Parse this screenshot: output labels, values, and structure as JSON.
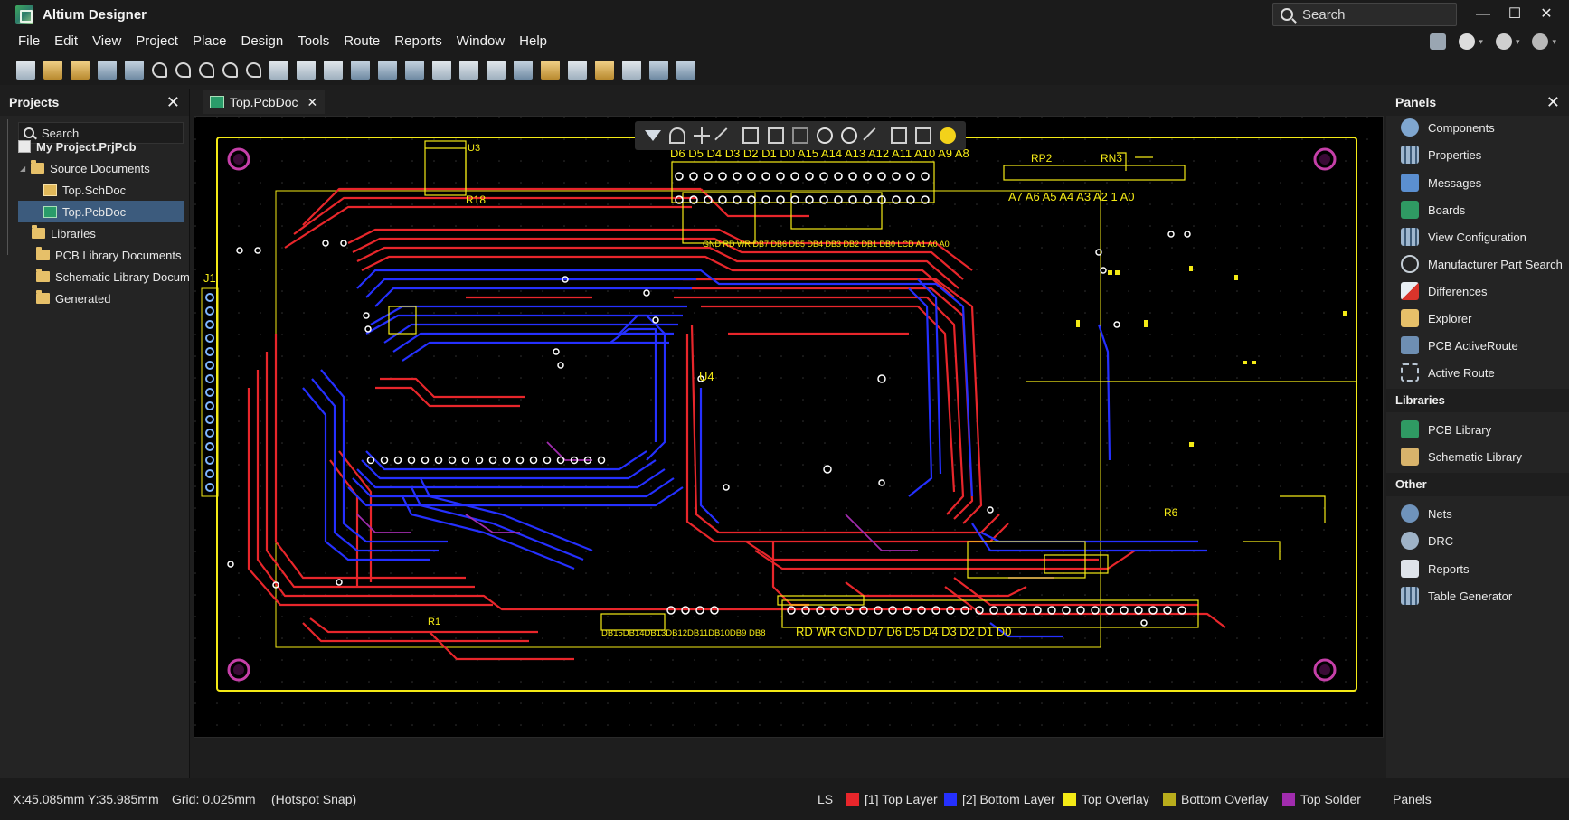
{
  "app": {
    "title": "Altium Designer",
    "search_placeholder": "Search"
  },
  "menu": [
    "File",
    "Edit",
    "View",
    "Project",
    "Place",
    "Design",
    "Tools",
    "Route",
    "Reports",
    "Window",
    "Help"
  ],
  "projects_panel": {
    "title": "Projects",
    "search_placeholder": "Search",
    "tree": [
      {
        "label": "My Project.PrjPcb",
        "type": "project",
        "bold": true
      },
      {
        "label": "Source Documents",
        "type": "folder"
      },
      {
        "label": "Top.SchDoc",
        "type": "schematic"
      },
      {
        "label": "Top.PcbDoc",
        "type": "pcb",
        "selected": true
      },
      {
        "label": "Libraries",
        "type": "folder"
      },
      {
        "label": "PCB Library Documents",
        "type": "folder"
      },
      {
        "label": "Schematic Library Docum",
        "type": "folder"
      },
      {
        "label": "Generated",
        "type": "folder"
      }
    ]
  },
  "document_tab": {
    "label": "Top.PcbDoc"
  },
  "pcb": {
    "labels": {
      "top_header": "D6 D5 D4 D3 D2 D1 D0 A15 A14 A13 A12 A11 A10 A9 A8",
      "right_header": "A7  A6  A5  A4  A3  A2 1  A0",
      "rp2": "RP2",
      "rn3": "RN3",
      "j1": "J1",
      "u4": "U4",
      "r18": "R18",
      "r1": "R1",
      "r6": "R6",
      "u3": "U3",
      "bottom_left": "DB15DB14DB13DB12DB11DB10DB9 DB8",
      "bottom_right": "RD WR   GND D7  D6  D5  D4  D3  D2  D1  D0",
      "mid_header": "GND RD WR DB7 DB6 DB5 DB4 DB3 DB2 DB1 DB0 LCD A1 A0 A0"
    },
    "colors": {
      "top_layer": "#e8262b",
      "bottom_layer": "#2530ff",
      "top_overlay": "#f4ea16",
      "bottom_overlay": "#b9ad1c",
      "top_solder": "#a12cae",
      "board_outline": "#f4ea16"
    }
  },
  "panels_panel": {
    "title": "Panels",
    "items": [
      {
        "label": "Components",
        "icon": "components-icon"
      },
      {
        "label": "Properties",
        "icon": "properties-icon"
      },
      {
        "label": "Messages",
        "icon": "messages-icon"
      },
      {
        "label": "Boards",
        "icon": "boards-icon"
      },
      {
        "label": "View Configuration",
        "icon": "view-config-icon"
      },
      {
        "label": "Manufacturer Part Search",
        "icon": "part-search-icon"
      },
      {
        "label": "Differences",
        "icon": "differences-icon"
      },
      {
        "label": "Explorer",
        "icon": "explorer-icon"
      },
      {
        "label": "PCB ActiveRoute",
        "icon": "activeroute-icon"
      },
      {
        "label": "Active Route",
        "icon": "active-route-icon"
      }
    ],
    "libraries_title": "Libraries",
    "libraries": [
      {
        "label": "PCB Library",
        "icon": "pcb-library-icon"
      },
      {
        "label": "Schematic Library",
        "icon": "schematic-library-icon"
      }
    ],
    "other_title": "Other",
    "other": [
      {
        "label": "Nets",
        "icon": "nets-icon"
      },
      {
        "label": "DRC",
        "icon": "drc-icon"
      },
      {
        "label": "Reports",
        "icon": "reports-icon"
      },
      {
        "label": "Table Generator",
        "icon": "table-generator-icon"
      }
    ]
  },
  "status": {
    "coords": "X:45.085mm Y:35.985mm",
    "grid": "Grid: 0.025mm",
    "snap": "(Hotspot Snap)",
    "ls": "LS",
    "layers": [
      {
        "label": "[1] Top Layer",
        "color": "#e8262b"
      },
      {
        "label": "[2] Bottom Layer",
        "color": "#2530ff"
      },
      {
        "label": "Top Overlay",
        "color": "#f4ea16"
      },
      {
        "label": "Bottom Overlay",
        "color": "#b9ad1c"
      },
      {
        "label": "Top Solder",
        "color": "#a12cae"
      }
    ],
    "panels_label": "Panels"
  }
}
